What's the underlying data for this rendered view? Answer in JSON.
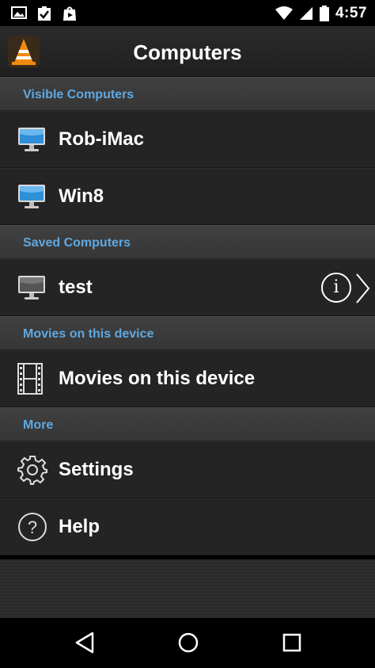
{
  "status_bar": {
    "time": "4:57",
    "left_icons": [
      "image-icon",
      "clipboard-check-icon",
      "play-store-icon"
    ],
    "right_icons": [
      "wifi-icon",
      "signal-icon",
      "battery-icon"
    ]
  },
  "app_bar": {
    "title": "Computers",
    "logo_icon": "vlc-cone-icon"
  },
  "sections": [
    {
      "header": "Visible Computers",
      "items": [
        {
          "label": "Rob-iMac",
          "icon": "monitor-icon"
        },
        {
          "label": "Win8",
          "icon": "monitor-icon"
        }
      ]
    },
    {
      "header": "Saved Computers",
      "items": [
        {
          "label": "test",
          "icon": "monitor-gray-icon",
          "info_glyph": "i"
        }
      ]
    },
    {
      "header": "Movies on this device",
      "items": [
        {
          "label": "Movies on this device",
          "icon": "film-strip-icon"
        }
      ]
    },
    {
      "header": "More",
      "items": [
        {
          "label": "Settings",
          "icon": "gear-icon"
        },
        {
          "label": "Help",
          "icon": "help-icon",
          "glyph": "?"
        }
      ]
    }
  ],
  "nav_bar": {
    "buttons": [
      "back-icon",
      "home-icon",
      "recents-icon"
    ]
  },
  "colors": {
    "section_header_text": "#5fa8e0",
    "row_background": "#242424",
    "monitor_screen": "#2f8fd8"
  }
}
